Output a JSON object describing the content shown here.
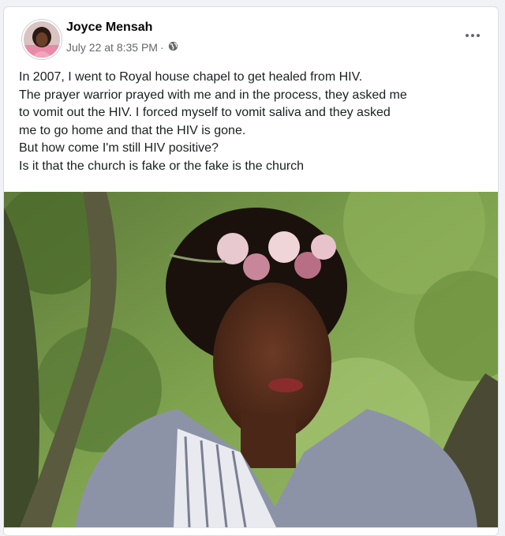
{
  "post": {
    "author": "Joyce Mensah",
    "timestamp": "July 22 at 8:35 PM",
    "separator": "·",
    "audience_icon": "globe-icon",
    "menu_icon": "more-options-icon",
    "text_lines": [
      "In 2007, I went to Royal house chapel to get healed from HIV.",
      "The prayer warrior prayed with me and in the process, they asked me",
      "to vomit out the HIV. I forced myself to vomit saliva and they asked",
      "me to go home and that the HIV is gone.",
      "But how come I'm still HIV positive?",
      "Is it that the church is fake or the fake is the church"
    ],
    "photo_icon": "woman-flower-crown-photo"
  },
  "colors": {
    "name": "#050505",
    "meta": "#65676b",
    "text": "#1c1e21",
    "background": "#f0f2f5"
  }
}
